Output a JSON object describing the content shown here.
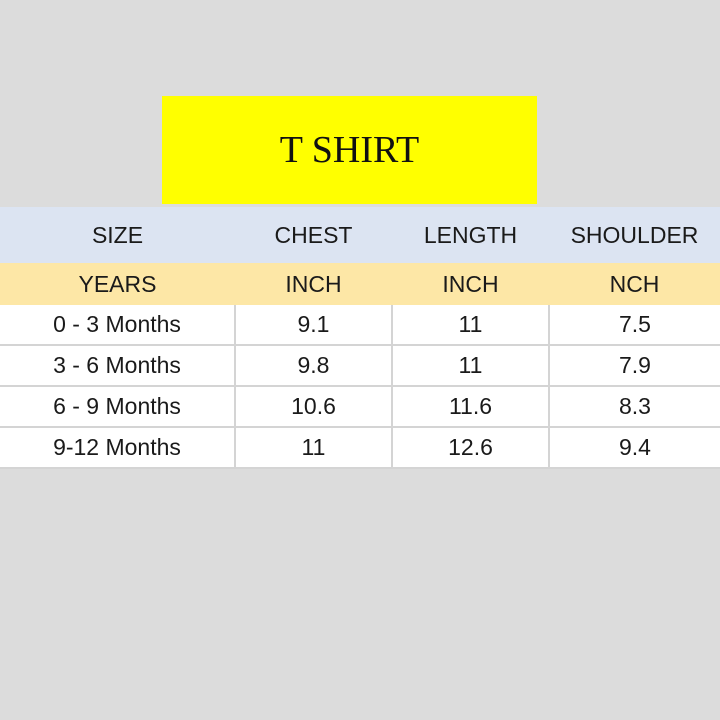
{
  "title": "T SHIRT",
  "header": [
    "SIZE",
    "CHEST",
    "LENGTH",
    "SHOULDER"
  ],
  "units": [
    "YEARS",
    "INCH",
    "INCH",
    "NCH"
  ],
  "rows": [
    [
      "0 - 3 Months",
      "9.1",
      "11",
      "7.5"
    ],
    [
      "3 - 6 Months",
      "9.8",
      "11",
      "7.9"
    ],
    [
      "6 - 9 Months",
      "10.6",
      "11.6",
      "8.3"
    ],
    [
      "9-12 Months",
      "11",
      "12.6",
      "9.4"
    ]
  ],
  "colors": {
    "title_bg": "#ffff00",
    "header_bg": "#dce4f2",
    "units_bg": "#fde7a6",
    "page_bg": "#dcdcdc"
  }
}
